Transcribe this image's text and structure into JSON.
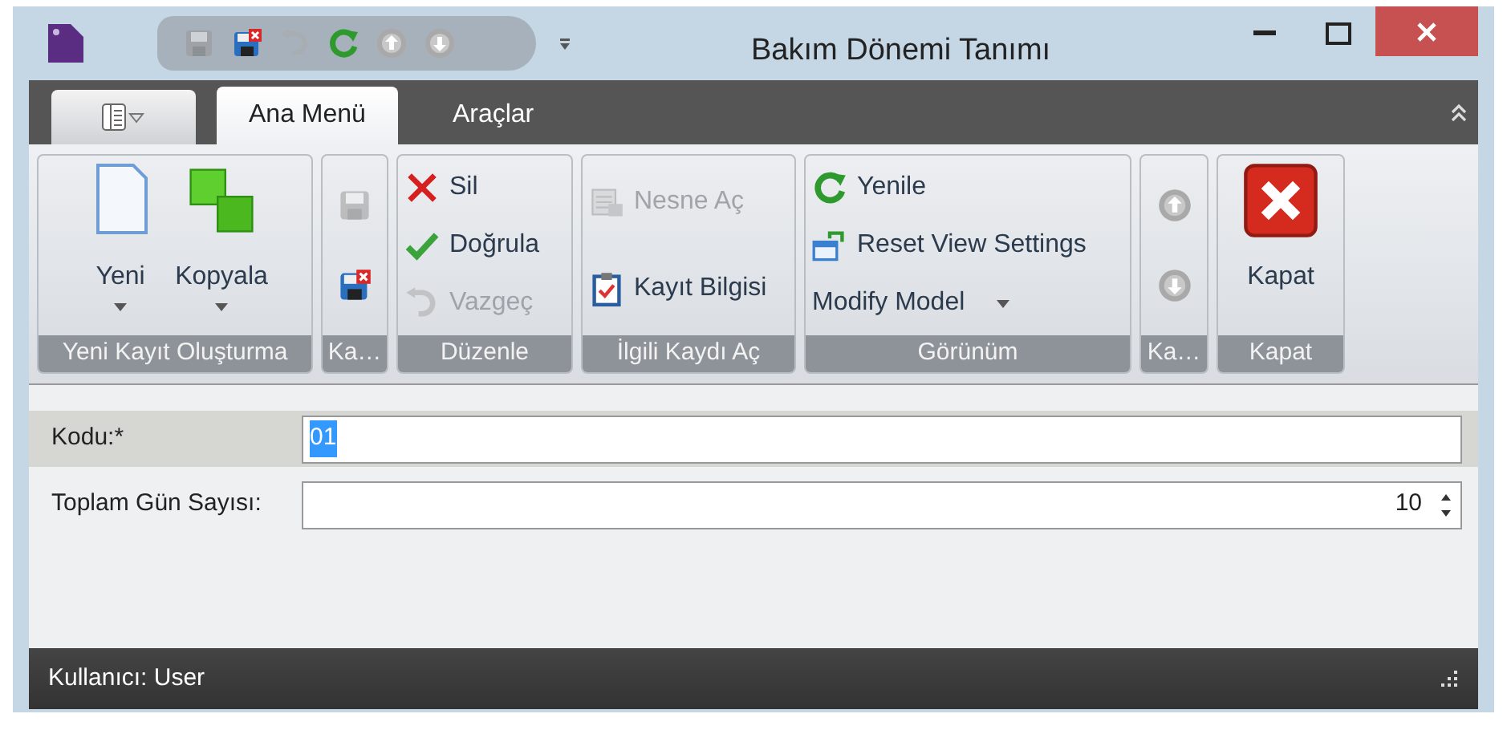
{
  "window": {
    "title": "Bakım Dönemi Tanımı"
  },
  "quick_access": [
    {
      "disabled": true
    },
    {
      "disabled": false
    },
    {
      "disabled": true
    },
    {
      "disabled": false
    },
    {
      "disabled": false
    },
    {
      "disabled": false
    }
  ],
  "ribbon_tabs": [
    {
      "label": "Ana Menü",
      "selected": true
    },
    {
      "label": "Araçlar",
      "selected": false
    }
  ],
  "ribbon_groups": [
    {
      "title": "Yeni Kayıt Oluşturma",
      "items": [
        {
          "kind": "large",
          "label": "Yeni",
          "dropdown": true,
          "disabled": false
        },
        {
          "kind": "large",
          "label": "Kopyala",
          "dropdown": true,
          "disabled": false
        }
      ]
    },
    {
      "title": "Ka…",
      "items": [
        {
          "kind": "icon",
          "disabled": true
        },
        {
          "kind": "icon",
          "disabled": false
        }
      ]
    },
    {
      "title": "Düzenle",
      "items": [
        {
          "kind": "small",
          "label": "Sil",
          "disabled": false
        },
        {
          "kind": "small",
          "label": "Doğrula",
          "disabled": false
        },
        {
          "kind": "small",
          "label": "Vazgeç",
          "disabled": true
        }
      ]
    },
    {
      "title": "İlgili Kaydı Aç",
      "items": [
        {
          "kind": "small",
          "label": "Nesne Aç",
          "disabled": true
        },
        {
          "kind": "small",
          "label": "Kayıt Bilgisi",
          "disabled": false
        }
      ]
    },
    {
      "title": "Görünüm",
      "items": [
        {
          "kind": "small",
          "label": "Yenile",
          "disabled": false
        },
        {
          "kind": "small",
          "label": "Reset View Settings",
          "disabled": false
        },
        {
          "kind": "small",
          "label": "Modify Model",
          "dropdown": true,
          "disabled": false
        }
      ]
    },
    {
      "title": "Ka…",
      "items": [
        {
          "kind": "icon",
          "disabled": false
        },
        {
          "kind": "icon",
          "disabled": false
        }
      ]
    },
    {
      "title": "Kapat",
      "items": [
        {
          "kind": "large",
          "label": "Kapat",
          "dropdown": false,
          "disabled": false
        }
      ]
    }
  ],
  "form_fields": [
    {
      "label": "Kodu:*",
      "value": "01",
      "kind": "text",
      "focused": true,
      "text_selected": true
    },
    {
      "label": "Toplam Gün Sayısı:",
      "value": "10",
      "kind": "spin",
      "focused": false,
      "text_selected": false
    }
  ],
  "status_bar": {
    "text": "Kullanıcı: User"
  }
}
